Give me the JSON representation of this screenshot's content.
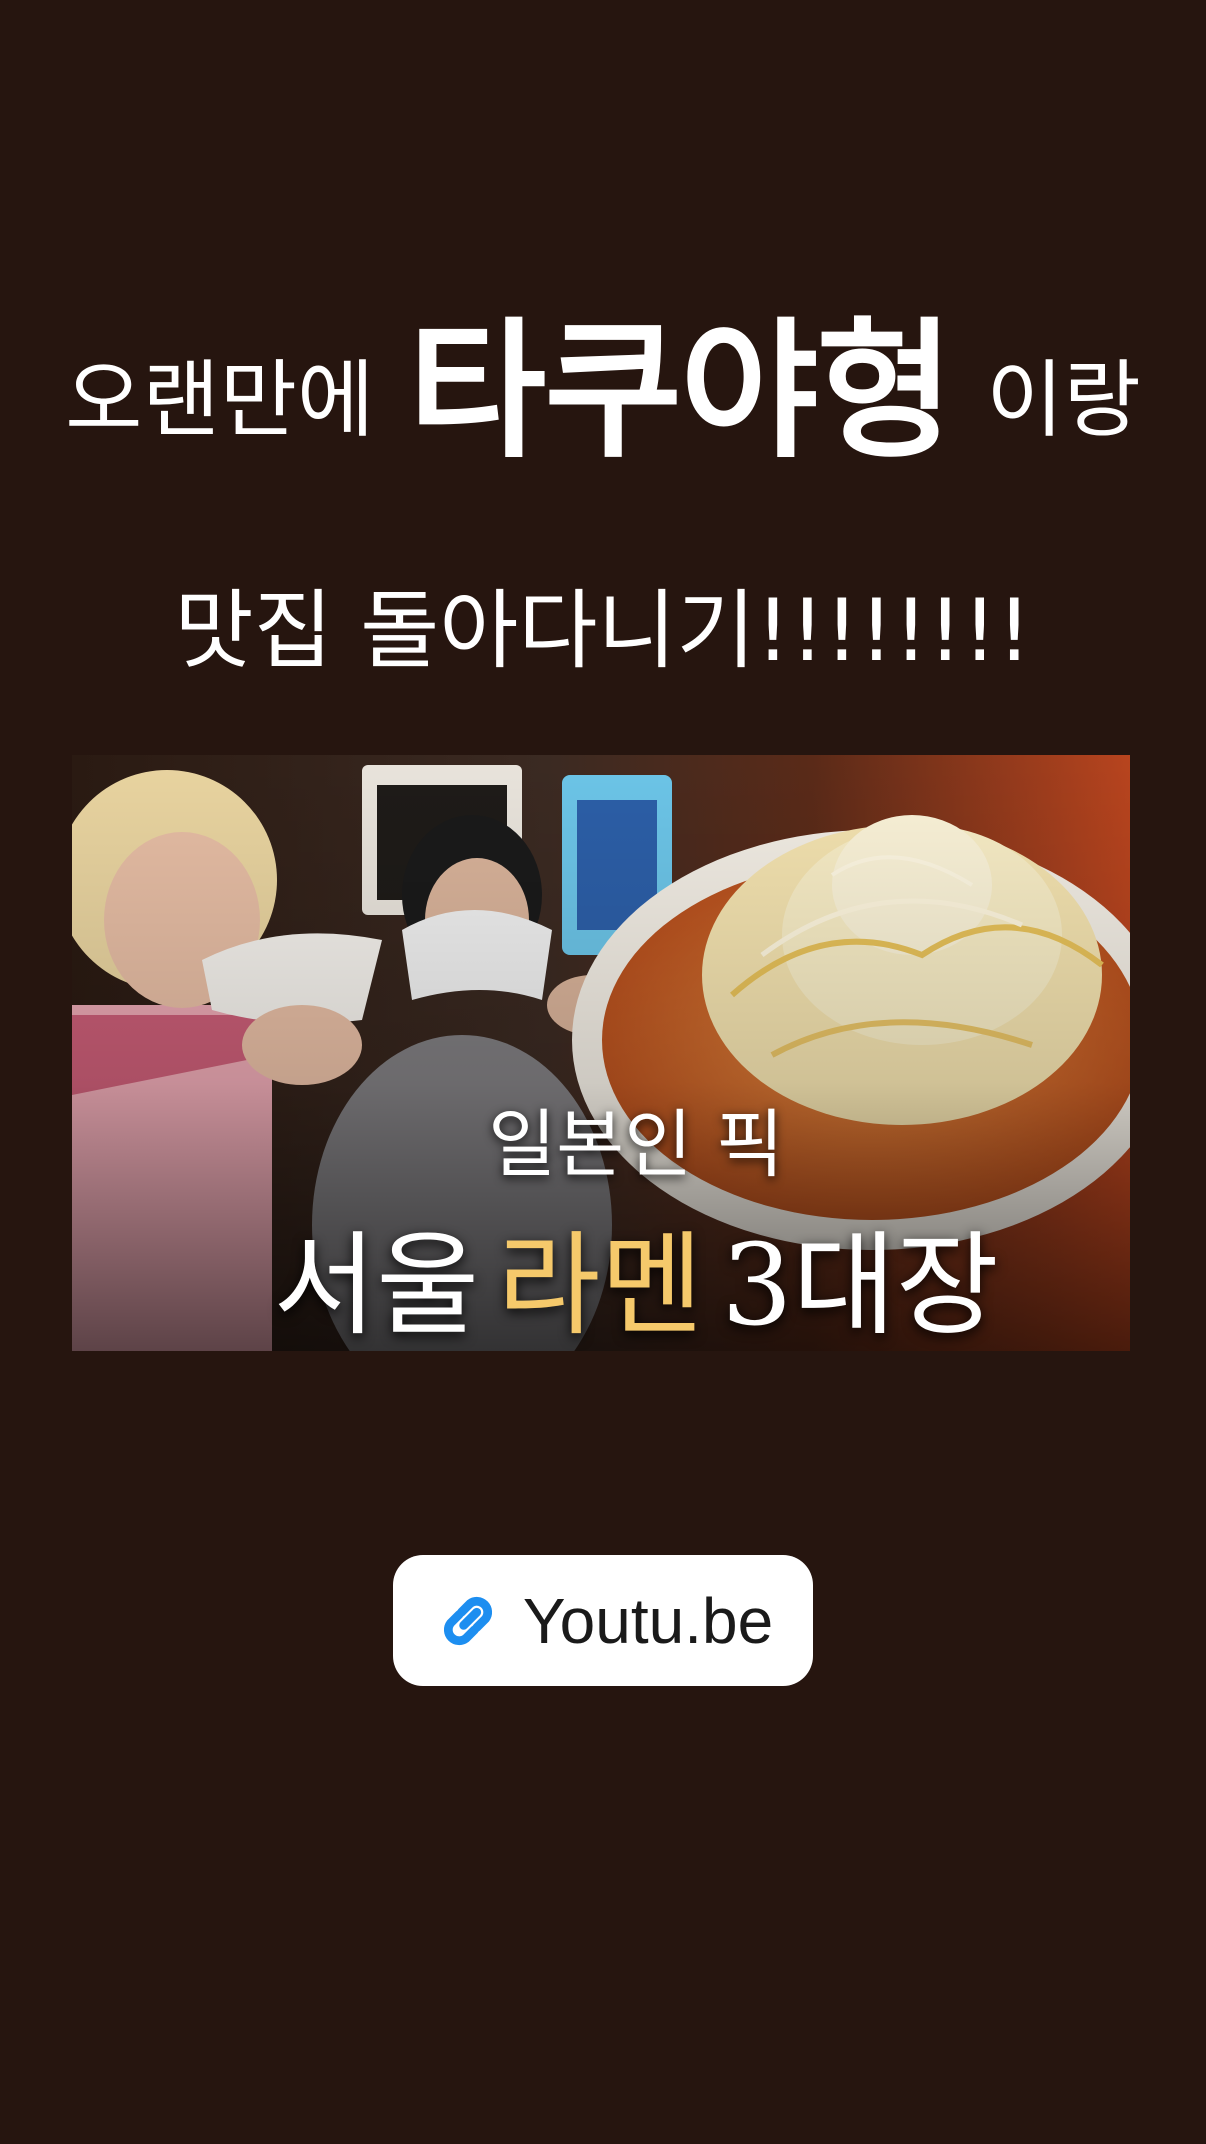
{
  "headline": {
    "line1_prefix": "오랜만에",
    "line1_name": "타쿠야형",
    "line1_suffix": "이랑",
    "line2": "맛집 돌아다니기!!!!!!!!"
  },
  "thumbnail": {
    "subtitle": "일본인 픽",
    "title_part1": "서울",
    "title_highlight": "라멘",
    "title_part2": "3대장",
    "highlight_color": "#f5c96b"
  },
  "link": {
    "icon": "link-icon",
    "label": "Youtu.be",
    "icon_color": "#1d8ef0"
  },
  "colors": {
    "background": "#26150f",
    "text": "#ffffff"
  }
}
